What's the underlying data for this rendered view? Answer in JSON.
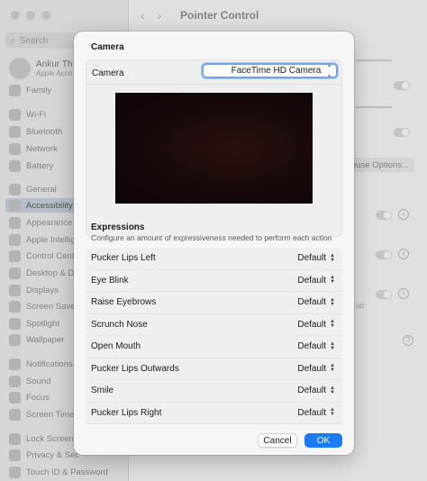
{
  "window": {
    "title": "Pointer Control",
    "search_placeholder": "Search",
    "user": {
      "name": "Ankur Th",
      "sub": "Apple Acco"
    },
    "sidebar_items": [
      {
        "label": "Family"
      },
      {
        "label": "Wi-Fi"
      },
      {
        "label": "Bluetooth"
      },
      {
        "label": "Network"
      },
      {
        "label": "Battery"
      },
      {
        "label": "General"
      },
      {
        "label": "Accessibility"
      },
      {
        "label": "Appearance"
      },
      {
        "label": "Apple Intellig"
      },
      {
        "label": "Control Cent"
      },
      {
        "label": "Desktop & D"
      },
      {
        "label": "Displays"
      },
      {
        "label": "Screen Saver"
      },
      {
        "label": "Spotlight"
      },
      {
        "label": "Wallpaper"
      },
      {
        "label": "Notifications"
      },
      {
        "label": "Sound"
      },
      {
        "label": "Focus"
      },
      {
        "label": "Screen Time"
      },
      {
        "label": "Lock Screen"
      },
      {
        "label": "Privacy & Sec"
      },
      {
        "label": "Touch ID & Password"
      }
    ],
    "mouse_options_label": "ouse Options...",
    "partial_text": "ad"
  },
  "sheet": {
    "camera_section_title": "Camera",
    "camera_label": "Camera",
    "camera_value": "FaceTime HD Camera",
    "expressions_title": "Expressions",
    "expressions_desc": "Configure an amount of expressiveness needed to perform each action",
    "expressions": [
      {
        "label": "Pucker Lips Left",
        "value": "Default"
      },
      {
        "label": "Eye Blink",
        "value": "Default"
      },
      {
        "label": "Raise Eyebrows",
        "value": "Default"
      },
      {
        "label": "Scrunch Nose",
        "value": "Default"
      },
      {
        "label": "Open Mouth",
        "value": "Default"
      },
      {
        "label": "Pucker Lips Outwards",
        "value": "Default"
      },
      {
        "label": "Smile",
        "value": "Default"
      },
      {
        "label": "Pucker Lips Right",
        "value": "Default"
      }
    ],
    "cancel_label": "Cancel",
    "ok_label": "OK"
  },
  "colors": {
    "accent": "#1b7bf5",
    "focus_ring": "#6aa5f5"
  }
}
